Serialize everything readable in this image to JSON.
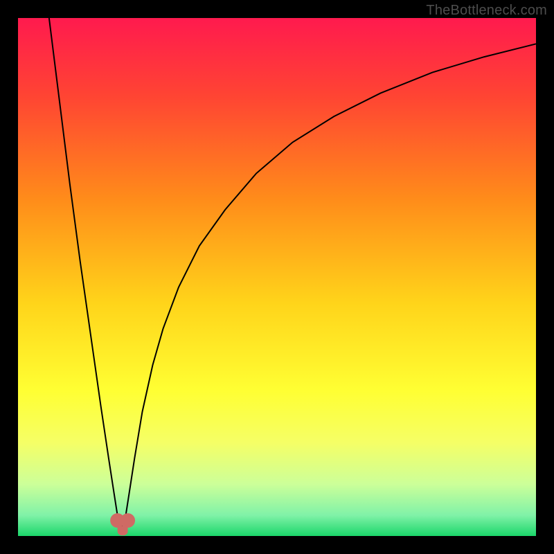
{
  "watermark": "TheBottleneck.com",
  "chart_data": {
    "type": "line",
    "title": "",
    "xlabel": "",
    "ylabel": "",
    "xlim": [
      0,
      100
    ],
    "ylim": [
      0,
      100
    ],
    "grid": false,
    "legend": false,
    "background_gradient": {
      "stops": [
        {
          "offset": 0.0,
          "color": "#ff1a4e"
        },
        {
          "offset": 0.15,
          "color": "#ff4433"
        },
        {
          "offset": 0.35,
          "color": "#ff8c1a"
        },
        {
          "offset": 0.55,
          "color": "#ffd41a"
        },
        {
          "offset": 0.72,
          "color": "#ffff33"
        },
        {
          "offset": 0.82,
          "color": "#f5ff66"
        },
        {
          "offset": 0.9,
          "color": "#ccff99"
        },
        {
          "offset": 0.96,
          "color": "#80f2a8"
        },
        {
          "offset": 1.0,
          "color": "#1bd66a"
        }
      ]
    },
    "series": [
      {
        "name": "curve",
        "color": "#000000",
        "stroke_width": 2,
        "x": [
          6.0,
          8.0,
          10.0,
          12.0,
          14.0,
          16.0,
          17.5,
          18.5,
          19.2,
          19.6,
          20.0,
          20.8,
          21.5,
          22.5,
          24.0,
          26.0,
          28.0,
          31.0,
          35.0,
          40.0,
          46.0,
          53.0,
          61.0,
          70.0,
          80.0,
          90.0,
          100.0
        ],
        "y": [
          100.0,
          84.0,
          68.0,
          53.0,
          39.0,
          25.0,
          15.0,
          8.5,
          4.0,
          2.0,
          2.0,
          4.0,
          8.5,
          15.0,
          24.0,
          33.0,
          40.0,
          48.0,
          56.0,
          63.0,
          70.0,
          76.0,
          81.0,
          85.5,
          89.5,
          92.5,
          95.0
        ]
      }
    ],
    "markers": [
      {
        "name": "trough-left",
        "shape": "circle",
        "color": "#cf6a64",
        "radius_pct": 1.4,
        "x": 19.2,
        "y": 3.0
      },
      {
        "name": "trough-right",
        "shape": "circle",
        "color": "#cf6a64",
        "radius_pct": 1.4,
        "x": 21.2,
        "y": 3.0
      }
    ],
    "trough_bridge": {
      "color": "#cf6a64",
      "width_pct": 2.8,
      "x1": 19.2,
      "x2": 21.2,
      "y": 1.5
    }
  }
}
